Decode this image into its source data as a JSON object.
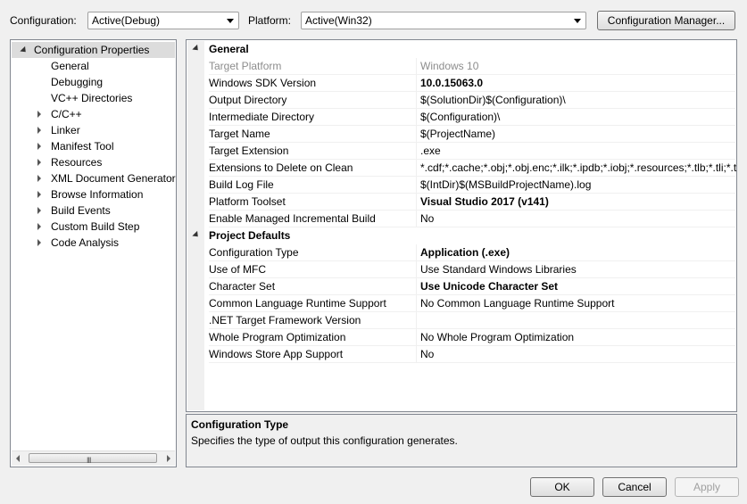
{
  "toolbar": {
    "configuration_label": "Configuration:",
    "configuration_value": "Active(Debug)",
    "platform_label": "Platform:",
    "platform_value": "Active(Win32)",
    "config_manager_label": "Configuration Manager..."
  },
  "tree": {
    "root": "Configuration Properties",
    "items": [
      "General",
      "Debugging",
      "VC++ Directories",
      "C/C++",
      "Linker",
      "Manifest Tool",
      "Resources",
      "XML Document Generator",
      "Browse Information",
      "Build Events",
      "Custom Build Step",
      "Code Analysis"
    ]
  },
  "grid": {
    "general_header": "General",
    "general": [
      {
        "name": "Target Platform",
        "value": "Windows 10"
      },
      {
        "name": "Windows SDK Version",
        "value": "10.0.15063.0"
      },
      {
        "name": "Output Directory",
        "value": "$(SolutionDir)$(Configuration)\\"
      },
      {
        "name": "Intermediate Directory",
        "value": "$(Configuration)\\"
      },
      {
        "name": "Target Name",
        "value": "$(ProjectName)"
      },
      {
        "name": "Target Extension",
        "value": ".exe"
      },
      {
        "name": "Extensions to Delete on Clean",
        "value": "*.cdf;*.cache;*.obj;*.obj.enc;*.ilk;*.ipdb;*.iobj;*.resources;*.tlb;*.tli;*.t"
      },
      {
        "name": "Build Log File",
        "value": "$(IntDir)$(MSBuildProjectName).log"
      },
      {
        "name": "Platform Toolset",
        "value": "Visual Studio 2017 (v141)"
      },
      {
        "name": "Enable Managed Incremental Build",
        "value": "No"
      }
    ],
    "defaults_header": "Project Defaults",
    "defaults": [
      {
        "name": "Configuration Type",
        "value": "Application (.exe)"
      },
      {
        "name": "Use of MFC",
        "value": "Use Standard Windows Libraries"
      },
      {
        "name": "Character Set",
        "value": "Use Unicode Character Set"
      },
      {
        "name": "Common Language Runtime Support",
        "value": "No Common Language Runtime Support"
      },
      {
        "name": ".NET Target Framework Version",
        "value": ""
      },
      {
        "name": "Whole Program Optimization",
        "value": "No Whole Program Optimization"
      },
      {
        "name": "Windows Store App Support",
        "value": "No"
      }
    ]
  },
  "description": {
    "title": "Configuration Type",
    "text": "Specifies the type of output this configuration generates."
  },
  "scrollbar": {
    "grip": "III"
  },
  "buttons": {
    "ok": "OK",
    "cancel": "Cancel",
    "apply": "Apply"
  }
}
